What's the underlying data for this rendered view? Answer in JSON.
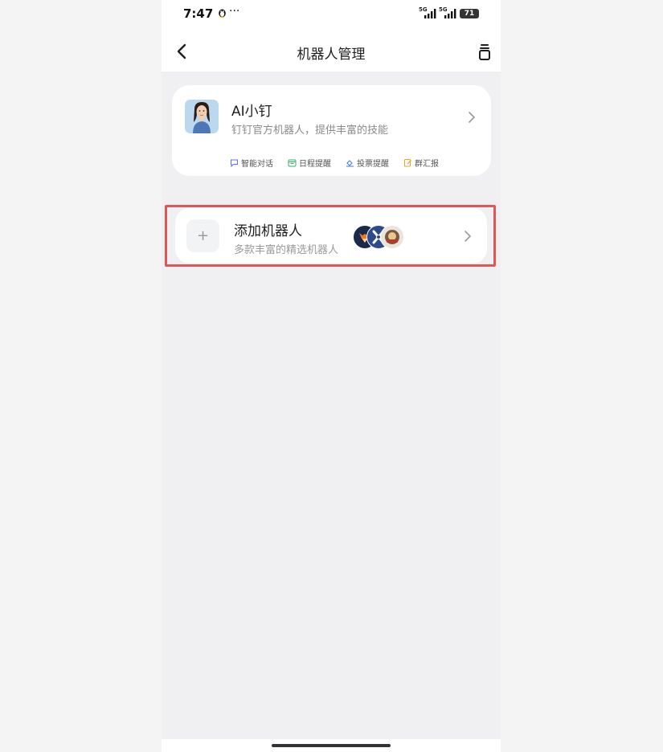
{
  "status_bar": {
    "time": "7:47",
    "dots": "···",
    "net1": "5G",
    "net2": "5G",
    "battery": "71"
  },
  "nav": {
    "title": "机器人管理",
    "back_icon": "chevron-left-icon",
    "right_icon": "cup-icon"
  },
  "ai_card": {
    "title": "AI小钉",
    "description": "钉钉官方机器人，提供丰富的技能",
    "tags": [
      {
        "label": "智能对话",
        "icon": "chat-bubble-icon",
        "color": "#5b6cf0"
      },
      {
        "label": "日程提醒",
        "icon": "calendar-icon",
        "color": "#2bb36a"
      },
      {
        "label": "投票提醒",
        "icon": "vote-icon",
        "color": "#3a7bd5"
      },
      {
        "label": "群汇报",
        "icon": "report-icon",
        "color": "#f0a020"
      }
    ]
  },
  "add_card": {
    "title": "添加机器人",
    "description": "多款丰富的精选机器人",
    "plus": "+"
  },
  "colors": {
    "highlight": "#e05556",
    "background": "#f0f0f3"
  }
}
